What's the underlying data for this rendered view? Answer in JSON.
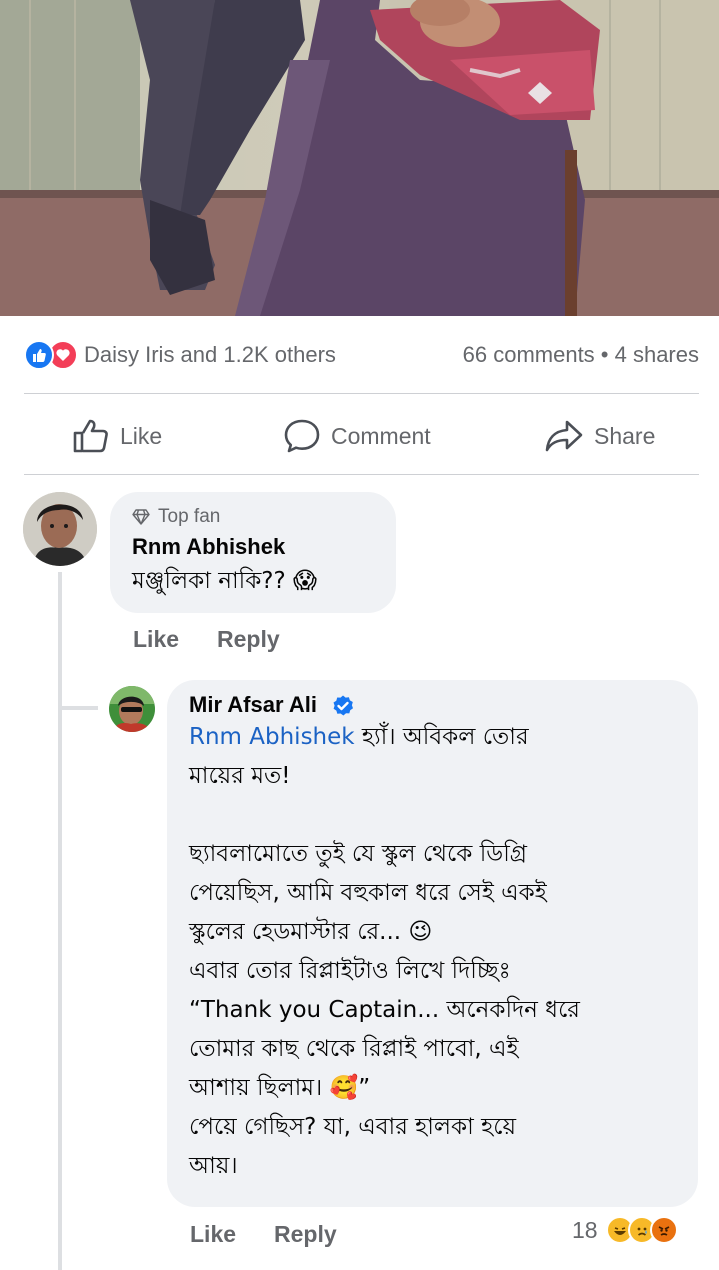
{
  "post": {
    "reactors_text": "Daisy Iris and 1.2K others",
    "counts_text": "66 comments • 4 shares",
    "actions": {
      "like": "Like",
      "comment": "Comment",
      "share": "Share"
    }
  },
  "comments": [
    {
      "badge": "Top fan",
      "author": "Rnm Abhishek",
      "text": "মঞ্জুলিকা নাকি?? 😱",
      "actions": {
        "like": "Like",
        "reply": "Reply"
      }
    }
  ],
  "reply": {
    "author": "Mir Afsar Ali",
    "mention": "Rnm Abhishek",
    "text": " হ্যাঁ। অবিকল তোর\nমায়ের মত!\n\nছ্যাবলামোতে তুই যে স্কুল থেকে ডিগ্রি\nপেয়েছিস, আমি বহুকাল ধরে সেই একই\nস্কুলের হেডমাস্টার রে... 😉\nএবার তোর রিপ্লাইটাও লিখে দিচ্ছিঃ\n“Thank you Captain... অনেকদিন ধরে\nতোমার কাছ থেকে রিপ্লাই পাবো, এই\nআশায় ছিলাম। 🥰”\nপেয়ে গেছিস? যা, এবার হালকা হয়ে\nআয়।",
    "actions": {
      "like": "Like",
      "reply": "Reply"
    },
    "reaction_count": "18",
    "reactions": [
      "haha",
      "sad",
      "angry"
    ]
  }
}
